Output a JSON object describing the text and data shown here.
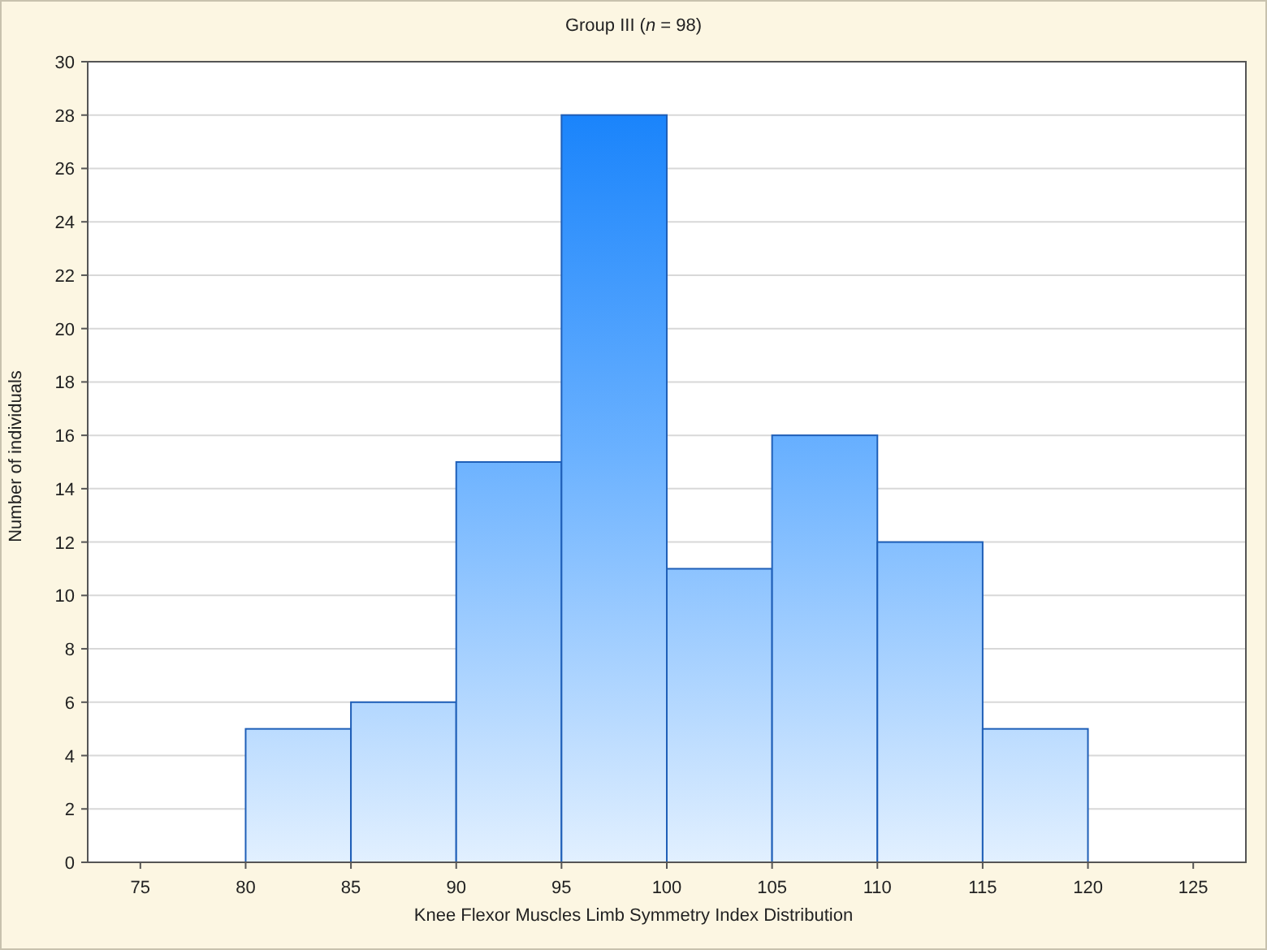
{
  "chart": {
    "chart_data": {
      "type": "bar",
      "title": "Group III (*n* = 98)",
      "xlabel": "Knee Flexor Muscles Limb Symmetry Index Distribution",
      "ylabel": "Number of individuals",
      "x": [
        82.5,
        87.5,
        92.5,
        97.5,
        102.5,
        107.5,
        112.5,
        117.5
      ],
      "values": [
        5,
        6,
        15,
        28,
        11,
        16,
        12,
        5
      ],
      "xlim": [
        72.5,
        127.5
      ],
      "grid": true,
      "ylim": [
        0,
        30
      ],
      "xticks": [
        75,
        80,
        85,
        90,
        95,
        100,
        105,
        110,
        115,
        120,
        125
      ],
      "yticks": [
        0,
        2,
        4,
        6,
        8,
        10,
        12,
        14,
        16,
        18,
        20,
        22,
        24,
        26,
        28,
        30
      ]
    }
  }
}
